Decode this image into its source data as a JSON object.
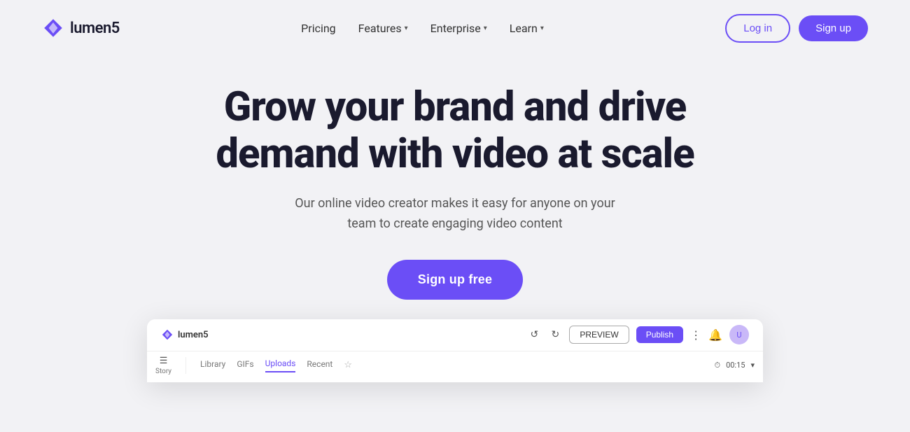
{
  "brand": {
    "name": "lumen5",
    "logo_icon": "diamond-icon"
  },
  "nav": {
    "links": [
      {
        "label": "Pricing",
        "has_dropdown": false
      },
      {
        "label": "Features",
        "has_dropdown": true
      },
      {
        "label": "Enterprise",
        "has_dropdown": true
      },
      {
        "label": "Learn",
        "has_dropdown": true
      }
    ],
    "login_label": "Log in",
    "signup_label": "Sign up"
  },
  "hero": {
    "title": "Grow your brand and drive demand with video at scale",
    "subtitle": "Our online video creator makes it easy for anyone on your team to create engaging video content",
    "cta_label": "Sign up free"
  },
  "app_preview": {
    "logo_text": "lumen5",
    "preview_btn": "PREVIEW",
    "publish_btn": "Publish",
    "tabs": [
      {
        "label": "Library"
      },
      {
        "label": "GIFs"
      },
      {
        "label": "Uploads",
        "active": true
      },
      {
        "label": "Recent"
      }
    ],
    "story_label": "Story",
    "timer": "00:15"
  },
  "colors": {
    "accent": "#6b4ef6",
    "background": "#f2f2f5"
  }
}
